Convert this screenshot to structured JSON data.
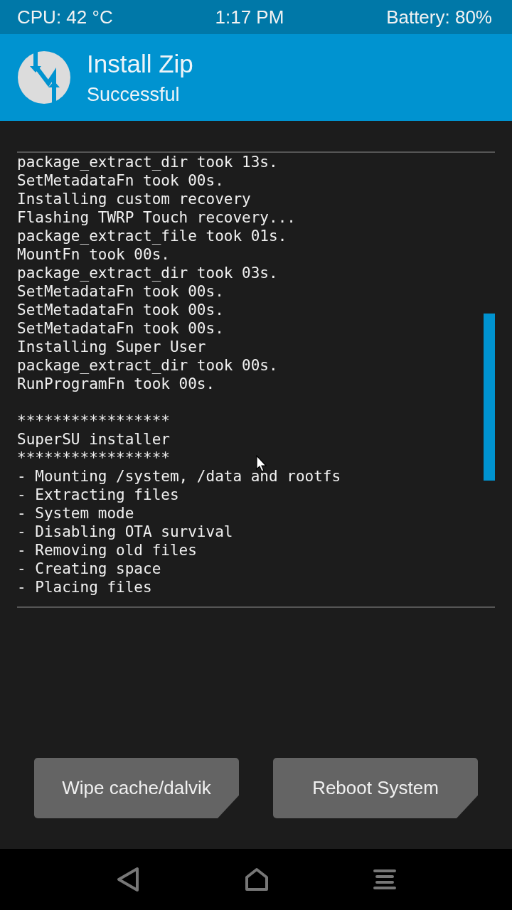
{
  "status_bar": {
    "cpu": "CPU: 42 °C",
    "time": "1:17 PM",
    "battery": "Battery: 80%"
  },
  "header": {
    "title": "Install Zip",
    "subtitle": "Successful"
  },
  "console": {
    "sections": [
      [
        "package_extract_dir took 13s.",
        "SetMetadataFn took 00s.",
        "Installing custom recovery",
        "Flashing TWRP Touch recovery...",
        "package_extract_file took 01s.",
        "MountFn took 00s.",
        "package_extract_dir took 03s.",
        "SetMetadataFn took 00s.",
        "SetMetadataFn took 00s.",
        "SetMetadataFn took 00s.",
        "Installing Super User",
        "package_extract_dir took 00s.",
        "RunProgramFn took 00s."
      ],
      [
        "*****************",
        "SuperSU installer",
        "*****************",
        "- Mounting /system, /data and rootfs",
        "- Extracting files",
        "- System mode",
        "- Disabling OTA survival",
        "- Removing old files",
        "- Creating space",
        "- Placing files"
      ]
    ]
  },
  "buttons": [
    "Wipe cache/dalvik",
    "Reboot System"
  ]
}
